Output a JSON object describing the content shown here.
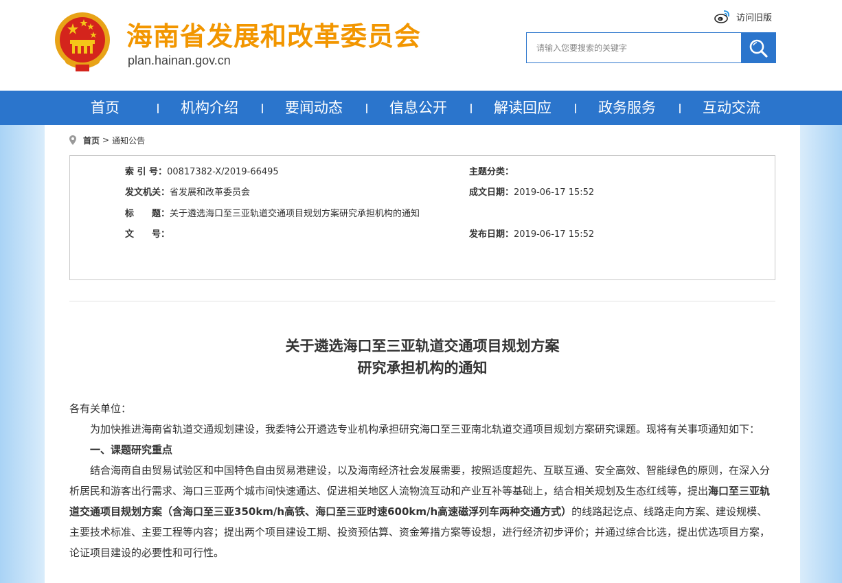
{
  "header": {
    "site_title": "海南省发展和改革委员会",
    "site_domain": "plan.hainan.gov.cn",
    "old_version_label": "访问旧版",
    "search_placeholder": "请输入您要搜索的关键字"
  },
  "nav": {
    "items": [
      "首页",
      "机构介绍",
      "要闻动态",
      "信息公开",
      "解读回应",
      "政务服务",
      "互动交流"
    ]
  },
  "breadcrumb": {
    "home": "首页",
    "separator": ">",
    "current": "通知公告"
  },
  "meta": {
    "index_label": "索 引 号：",
    "index_value": "00817382-X/2019-66495",
    "topic_label": "主题分类：",
    "topic_value": "",
    "issuer_label": "发文机关：",
    "issuer_value": "省发展和改革委员会",
    "created_label": "成文日期：",
    "created_value": "2019-06-17 15:52",
    "title_label": "标　　题：",
    "title_value": "关于遴选海口至三亚轨道交通项目规划方案研究承担机构的通知",
    "docno_label": "文　　号：",
    "docno_value": "",
    "published_label": "发布日期：",
    "published_value": "2019-06-17 15:52"
  },
  "article": {
    "title_line1": "关于遴选海口至三亚轨道交通项目规划方案",
    "title_line2": "研究承担机构的通知",
    "salutation": "各有关单位：",
    "para1": "为加快推进海南省轨道交通规划建设，我委特公开遴选专业机构承担研究海口至三亚南北轨道交通项目规划方案研究课题。现将有关事项通知如下：",
    "section1_heading": "一、课题研究重点",
    "para2_before": "结合海南自由贸易试验区和中国特色自由贸易港建设，以及海南经济社会发展需要，按照适度超先、互联互通、安全高效、智能绿色的原则，在深入分析居民和游客出行需求、海口三亚两个城市间快速通达、促进相关地区人流物流互动和产业互补等基础上，结合相关规划及生态红线等，提出",
    "para2_bold": "海口至三亚轨道交通项目规划方案（含海口至三亚350km/h高铁、海口至三亚时速600km/h高速磁浮列车两种交通方式）",
    "para2_after": "的线路起讫点、线路走向方案、建设规模、主要技术标准、主要工程等内容；提出两个项目建设工期、投资预估算、资金筹措方案等设想，进行经济初步评价；并通过综合比选，提出优选项目方案，论证项目建设的必要性和可行性。"
  },
  "colors": {
    "brand_blue": "#2b75cc",
    "title_orange": "#f29600",
    "side_bg": "#a9d3f5"
  }
}
